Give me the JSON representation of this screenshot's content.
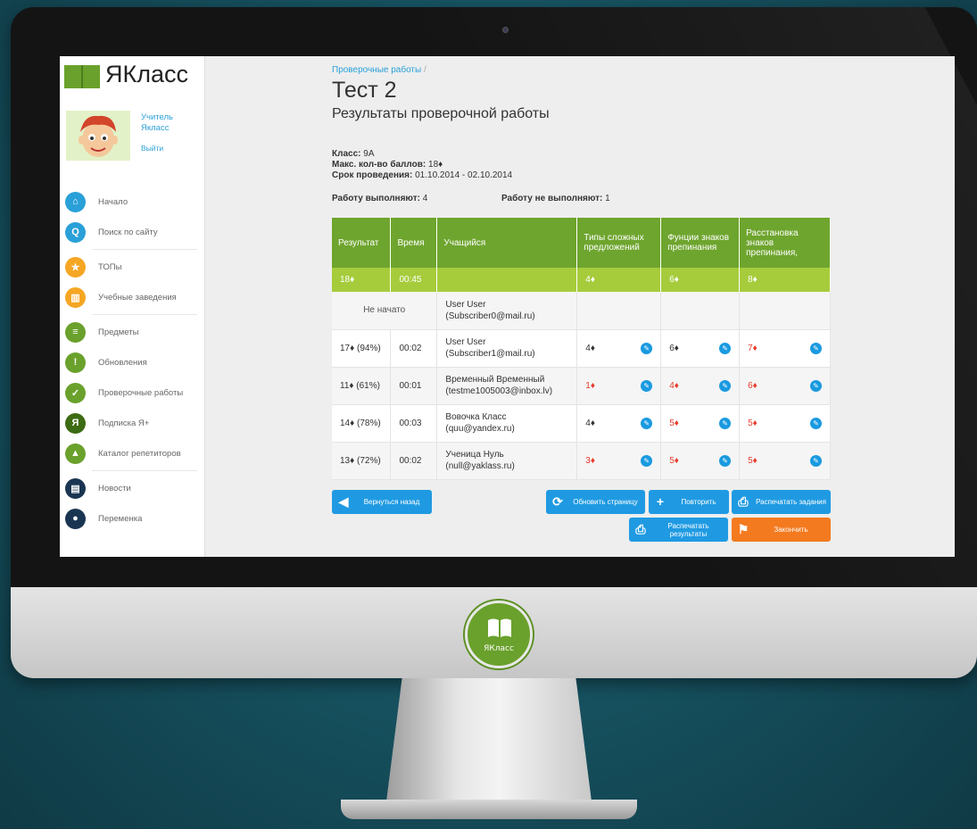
{
  "brand": {
    "name": "ЯКласс",
    "badge_label": "ЯКласс"
  },
  "user": {
    "name": "Учитель Якласс",
    "logout": "Выйти"
  },
  "sidebar": {
    "items": [
      {
        "label": "Начало",
        "icon": "home-icon",
        "color": "#2aa0d8"
      },
      {
        "label": "Поиск по сайту",
        "icon": "search-icon",
        "color": "#2aa0d8"
      },
      {
        "label": "ТОПы",
        "icon": "star-icon",
        "color": "#f5a623"
      },
      {
        "label": "Учебные заведения",
        "icon": "building-icon",
        "color": "#f5a623"
      },
      {
        "label": "Предметы",
        "icon": "subjects-icon",
        "color": "#6aa12c"
      },
      {
        "label": "Обновления",
        "icon": "exclamation-icon",
        "color": "#6aa12c"
      },
      {
        "label": "Проверочные работы",
        "icon": "check-icon",
        "color": "#6aa12c"
      },
      {
        "label": "Подписка Я+",
        "icon": "ya-plus-icon",
        "color": "#6aa12c"
      },
      {
        "label": "Каталог репетиторов",
        "icon": "graduation-cap-icon",
        "color": "#6aa12c"
      },
      {
        "label": "Новости",
        "icon": "chat-icon",
        "color": "#1a3552"
      },
      {
        "label": "Переменка",
        "icon": "cup-icon",
        "color": "#1a3552"
      }
    ]
  },
  "page": {
    "breadcrumb": "Проверочные работы",
    "breadcrumb_sep": "/",
    "title": "Тест 2",
    "subtitle": "Результаты проверочной работы",
    "class_label": "Класс:",
    "class_value": "9А",
    "max_label": "Макс. кол-во баллов:",
    "max_value": "18♦",
    "period_label": "Срок проведения:",
    "period_value": "01.10.2014 - 02.10.2014",
    "doing_label": "Работу выполняют:",
    "doing_value": "4",
    "not_doing_label": "Работу не выполняют:",
    "not_doing_value": "1"
  },
  "table": {
    "headers": [
      "Результат",
      "Время",
      "Учащийся",
      "Типы сложных предложений",
      "Фунции знаков препинания",
      "Расстановка знаков препинания,"
    ],
    "summary": {
      "result": "18♦",
      "time": "00:45",
      "t1": "4♦",
      "t2": "6♦",
      "t3": "8♦"
    },
    "rows": [
      {
        "not_started": "Не начато",
        "name": "User User",
        "email": "(Subscriber0@mail.ru)"
      },
      {
        "result": "17♦ (94%)",
        "time": "00:02",
        "name": "User User",
        "email": "(Subscriber1@mail.ru)",
        "s1": "4♦",
        "s2": "6♦",
        "s3": "7♦",
        "c1": "#333333",
        "c2": "#333333",
        "c3": "#e83b2c"
      },
      {
        "result": "11♦ (61%)",
        "time": "00:01",
        "name": "Временный Временный",
        "email": "(testme1005003@inbox.lv)",
        "s1": "1♦",
        "s2": "4♦",
        "s3": "6♦",
        "c1": "#e83b2c",
        "c2": "#e83b2c",
        "c3": "#e83b2c"
      },
      {
        "result": "14♦ (78%)",
        "time": "00:03",
        "name": "Вовочка Класс",
        "email": "(quu@yandex.ru)",
        "s1": "4♦",
        "s2": "5♦",
        "s3": "5♦",
        "c1": "#333333",
        "c2": "#e83b2c",
        "c3": "#e83b2c"
      },
      {
        "result": "13♦ (72%)",
        "time": "00:02",
        "name": "Ученица Нуль",
        "email": "(null@yaklass.ru)",
        "s1": "3♦",
        "s2": "5♦",
        "s3": "5♦",
        "c1": "#e83b2c",
        "c2": "#e83b2c",
        "c3": "#e83b2c"
      }
    ]
  },
  "buttons": {
    "back": "Вернуться назад",
    "refresh": "Обновить страницу",
    "repeat": "Повторить",
    "print_tasks": "Распечатать задания",
    "print_results": "Распечатать результаты",
    "finish": "Закончить"
  },
  "colors": {
    "green": "#6ea52e",
    "light_green": "#a6cc3c",
    "blue": "#1f9ae2",
    "orange": "#f47a20",
    "red": "#e83b2c"
  }
}
